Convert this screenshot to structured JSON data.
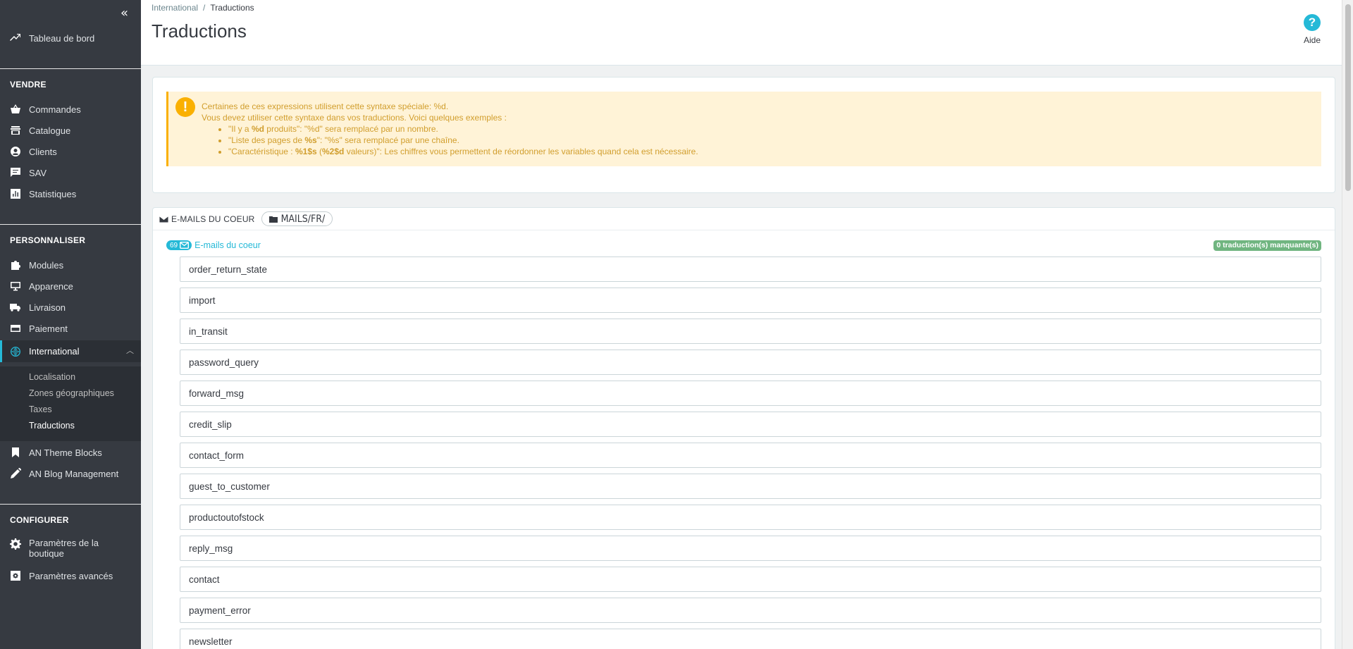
{
  "sidebar": {
    "dashboard": "Tableau de bord",
    "sections": {
      "sell": "VENDRE",
      "customize": "PERSONNALISER",
      "configure": "CONFIGURER"
    },
    "sell_items": [
      "Commandes",
      "Catalogue",
      "Clients",
      "SAV",
      "Statistiques"
    ],
    "customize_items": [
      "Modules",
      "Apparence",
      "Livraison",
      "Paiement",
      "International"
    ],
    "international_sub": [
      "Localisation",
      "Zones géographiques",
      "Taxes",
      "Traductions"
    ],
    "extra_items": [
      "AN Theme Blocks",
      "AN Blog Management"
    ],
    "configure_items": [
      "Paramètres de la boutique",
      "Paramètres avancés"
    ]
  },
  "header": {
    "breadcrumb_parent": "International",
    "breadcrumb_current": "Traductions",
    "title": "Traductions",
    "help_label": "Aide"
  },
  "alert": {
    "line1": "Certaines de ces expressions utilisent cette syntaxe spéciale: %d.",
    "line2": "Vous devez utiliser cette syntaxe dans vos traductions. Voici quelques exemples :",
    "ex1_a": "\"Il y a ",
    "ex1_b": "%d",
    "ex1_c": " produits\": \"%d\" sera remplacé par un nombre.",
    "ex2_a": "\"Liste des pages de ",
    "ex2_b": "%s",
    "ex2_c": "\": \"%s\" sera remplacé par une chaîne.",
    "ex3_a": "\"Caractéristique : ",
    "ex3_b": "%1$s",
    "ex3_c": " (",
    "ex3_d": "%2$d",
    "ex3_e": " valeurs)\": Les chiffres vous permettent de réordonner les variables quand cela est nécessaire."
  },
  "mails_panel": {
    "heading": "E-MAILS DU COEUR",
    "folder": "MAILS/FR/",
    "group_count": "69",
    "group_label": "E-mails du coeur",
    "missing": "0 traduction(s) manquante(s)",
    "items": [
      "order_return_state",
      "import",
      "in_transit",
      "password_query",
      "forward_msg",
      "credit_slip",
      "contact_form",
      "guest_to_customer",
      "productoutofstock",
      "reply_msg",
      "contact",
      "payment_error",
      "newsletter"
    ]
  },
  "colors": {
    "sidebar_bg": "#363a41",
    "accent": "#25b9d7",
    "alert_bg": "#fff3d7",
    "alert_text": "#d19e2d",
    "success": "#70b580"
  }
}
